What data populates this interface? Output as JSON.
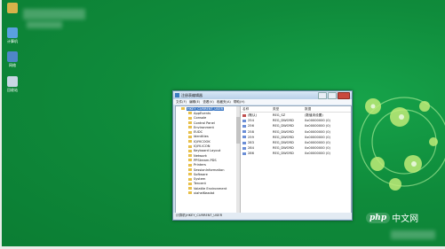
{
  "desktop": {
    "icons": [
      {
        "label": "",
        "color": "#d7b24a"
      },
      {
        "label": "计算机",
        "color": "#5aa0e0"
      },
      {
        "label": "网络",
        "color": "#4f86c8"
      },
      {
        "label": "回收站",
        "color": "#c8d6e4"
      }
    ]
  },
  "window": {
    "title": "注册表编辑器",
    "menu": [
      "文件(F)",
      "编辑(E)",
      "查看(V)",
      "收藏夹(A)",
      "帮助(H)"
    ],
    "tree": [
      "HKEY_CURRENT_USER",
      "AppEvents",
      "Console",
      "Control Panel",
      "Environment",
      "EUDC",
      "Identities",
      "IQIYICOOK",
      "IQIYI.ICON",
      "Keyboard Layout",
      "Network",
      "PPStream.PDS",
      "Printers",
      "SessionInformation",
      "Software",
      "System",
      "Tencent",
      "Volatile Environment",
      "xiaheiKeadat"
    ],
    "columns": {
      "name": "名称",
      "type": "类型",
      "data": "数据"
    },
    "values": [
      {
        "name": "(默认)",
        "type": "REG_SZ",
        "data": "(数值未设置)"
      },
      {
        "name": "254",
        "type": "REG_DWORD",
        "data": "0x00000000 (0)"
      },
      {
        "name": "256",
        "type": "REG_DWORD",
        "data": "0x00000000 (0)"
      },
      {
        "name": "258",
        "type": "REG_DWORD",
        "data": "0x00000000 (0)"
      },
      {
        "name": "259",
        "type": "REG_DWORD",
        "data": "0x00000000 (0)"
      },
      {
        "name": "283",
        "type": "REG_DWORD",
        "data": "0x00000000 (0)"
      },
      {
        "name": "284",
        "type": "REG_DWORD",
        "data": "0x00000000 (0)"
      },
      {
        "name": "286",
        "type": "REG_DWORD",
        "data": "0x00000000 (0)"
      }
    ],
    "status": "计算机\\HKEY_CURRENT_USER"
  },
  "watermark": {
    "brand": "php",
    "suffix": "中文网"
  },
  "colors": {
    "desktop": "#0d8a3a",
    "accent": "#3a78c4"
  }
}
